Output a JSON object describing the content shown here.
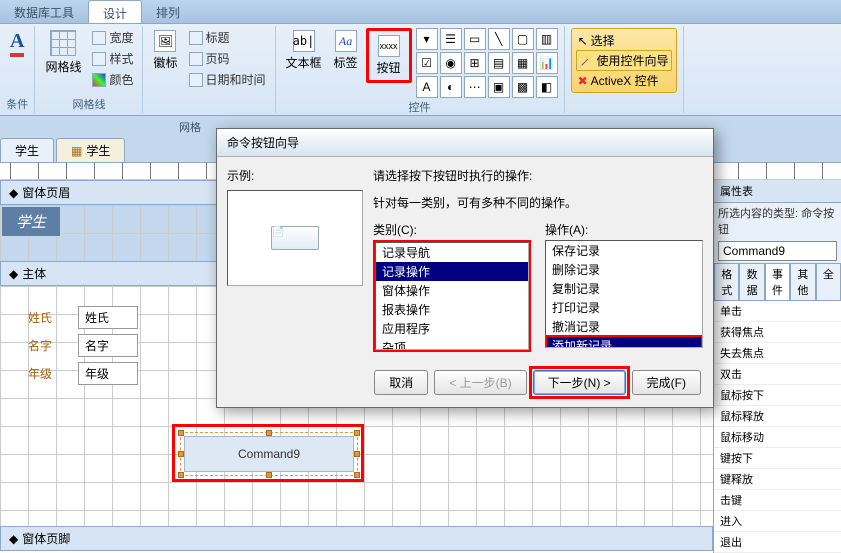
{
  "ribbon": {
    "tabs": [
      "数据库工具",
      "设计",
      "排列"
    ],
    "active_tab": "设计",
    "groups": {
      "font_btn": "A",
      "conditional": "条件",
      "grid": "网格线",
      "width": "宽度",
      "style": "样式",
      "color": "颜色",
      "gridlabel": "网格线",
      "logo": "徽标",
      "title": "标题",
      "pageno": "页码",
      "datetime": "日期和时间",
      "textbox": "文本框",
      "label": "标签",
      "button": "按钮",
      "controls": "控件",
      "select": "选择",
      "usewizard": "使用控件向导",
      "activex": "ActiveX 控件"
    }
  },
  "breadcrumbs": "网格",
  "doc_tabs": [
    "学生",
    "学生"
  ],
  "form": {
    "section_header": "窗体页眉",
    "section_body": "主体",
    "section_footer": "窗体页脚",
    "title": "学生",
    "fields": [
      {
        "label": "姓氏",
        "box": "姓氏"
      },
      {
        "label": "名字",
        "box": "名字"
      },
      {
        "label": "年级",
        "box": "年级"
      }
    ],
    "command_caption": "Command9"
  },
  "prop": {
    "title": "属性表",
    "subtitle": "所选内容的类型: 命令按钮",
    "selected": "Command9",
    "tabs": [
      "格式",
      "数据",
      "事件",
      "其他",
      "全"
    ],
    "active_tab": "事件",
    "events": [
      "单击",
      "获得焦点",
      "失去焦点",
      "双击",
      "鼠标按下",
      "鼠标释放",
      "鼠标移动",
      "键按下",
      "键释放",
      "击键",
      "进入",
      "退出"
    ]
  },
  "dialog": {
    "title": "命令按钮向导",
    "example": "示例:",
    "instruction1": "请选择按下按钮时执行的操作:",
    "instruction2": "针对每一类别，可有多种不同的操作。",
    "cat_label": "类别(C):",
    "act_label": "操作(A):",
    "categories": [
      "记录导航",
      "记录操作",
      "窗体操作",
      "报表操作",
      "应用程序",
      "杂项"
    ],
    "cat_selected": "记录操作",
    "actions": [
      "保存记录",
      "删除记录",
      "复制记录",
      "打印记录",
      "撤消记录",
      "添加新记录"
    ],
    "act_selected": "添加新记录",
    "btn_cancel": "取消",
    "btn_back": "< 上一步(B)",
    "btn_next": "下一步(N) >",
    "btn_finish": "完成(F)"
  }
}
